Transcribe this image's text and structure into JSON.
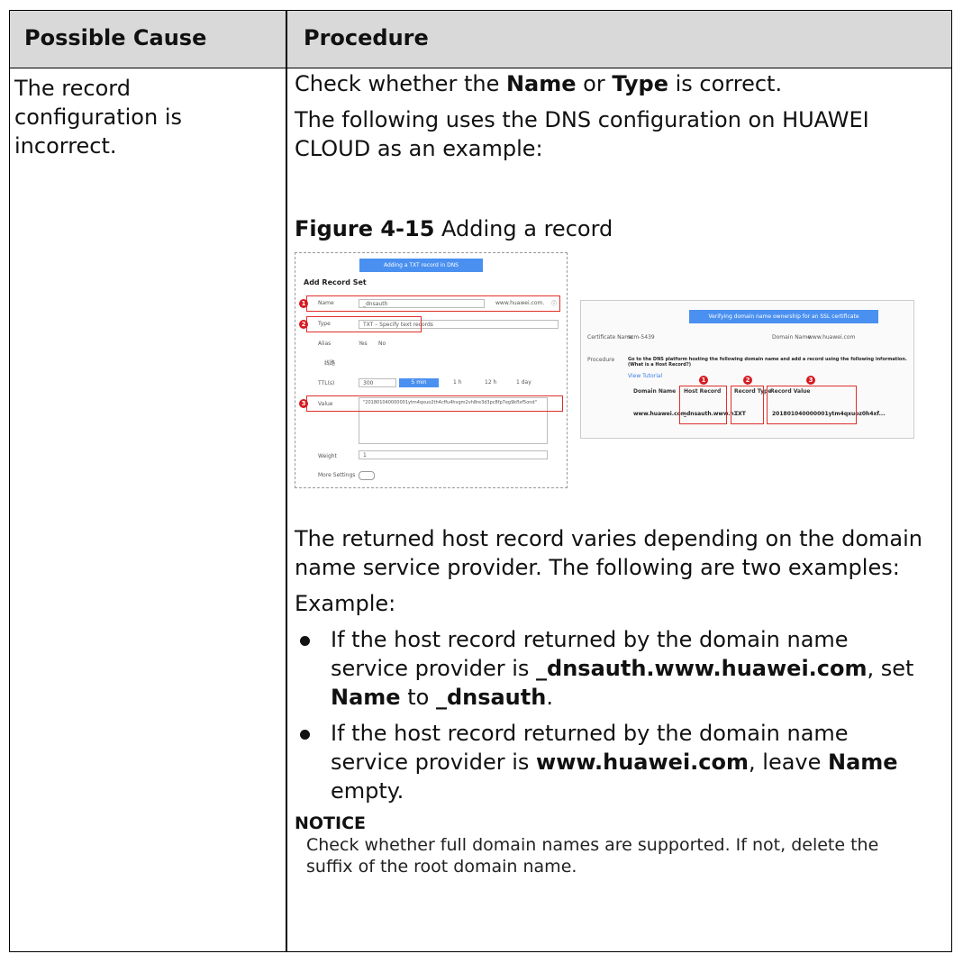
{
  "table": {
    "header_cause": "Possible Cause",
    "header_procedure": "Procedure"
  },
  "cause": "The record configuration is incorrect.",
  "procedure": {
    "p1_pre": "Check whether the ",
    "p1_name": "Name",
    "p1_mid": " or ",
    "p1_type": "Type",
    "p1_post": " is correct.",
    "p2": "The following uses the DNS configuration on HUAWEI CLOUD as an example:",
    "figure_label": "Figure 4-15",
    "figure_caption": " Adding a record"
  },
  "figure_left": {
    "banner": "Adding a TXT record in DNS",
    "section_title": "Add Record Set",
    "name_label": "Name",
    "name_value": "_dnsauth",
    "name_suffix": "www.huawei.com.",
    "type_label": "Type",
    "type_value": "TXT – Specify text records",
    "alias_label": "Alias",
    "alias_yes": "Yes",
    "alias_no": "No",
    "line_label": "线路",
    "ttl_label": "TTL(s)",
    "ttl_value": "300",
    "ttl_opts": [
      "5 min",
      "1 h",
      "12 h",
      "1 day"
    ],
    "value_label": "Value",
    "value_text": "\"201801040000001ytm4qxuo2th4cffu4hvgm2vh8re3d3pc8fp7eg9kflxf5ond\"",
    "weight_label": "Weight",
    "weight_value": "1",
    "more_label": "More Settings",
    "markers": [
      "1",
      "2",
      "3"
    ]
  },
  "figure_right": {
    "banner": "Verifying domain name ownership for an SSL certificate",
    "cert_label": "Certificate Name",
    "cert_value": "scm-5439",
    "domain_label": "Domain Name",
    "domain_value": "www.huawei.com",
    "procedure_label": "Procedure",
    "procedure_text": "Go to the DNS platform hosting the following domain name and add a record using the following information.(What is a Host Record?)",
    "view_tutorial": "View Tutorial",
    "col_domain": "Domain Name",
    "col_host": "Host Record",
    "col_type": "Record Type",
    "col_value": "Record Value",
    "row_domain": "www.huawei.com",
    "row_host": "_dnsauth.www.h...",
    "row_type": "TXT",
    "row_value": "201801040000001ytm4qxuoz0h4xf...",
    "markers": [
      "1",
      "2",
      "3"
    ]
  },
  "lower": {
    "p1": "The returned host record varies depending on the domain name service provider. The following are two examples:",
    "p2": "Example:",
    "b1_pre": "If the host record returned by the domain name service provider is ",
    "b1_host": "_dnsauth.www.huawei.com",
    "b1_mid": ", set ",
    "b1_name": "Name",
    "b1_to": " to ",
    "b1_val": "_dnsauth",
    "b1_end": ".",
    "b2_pre": "If the host record returned by the domain name service provider is ",
    "b2_host": "www.huawei.com",
    "b2_mid": ", leave ",
    "b2_name": "Name",
    "b2_end": " empty.",
    "notice_title": "NOTICE",
    "notice_body": "Check whether full domain names are supported. If not, delete the suffix of the root domain name."
  }
}
